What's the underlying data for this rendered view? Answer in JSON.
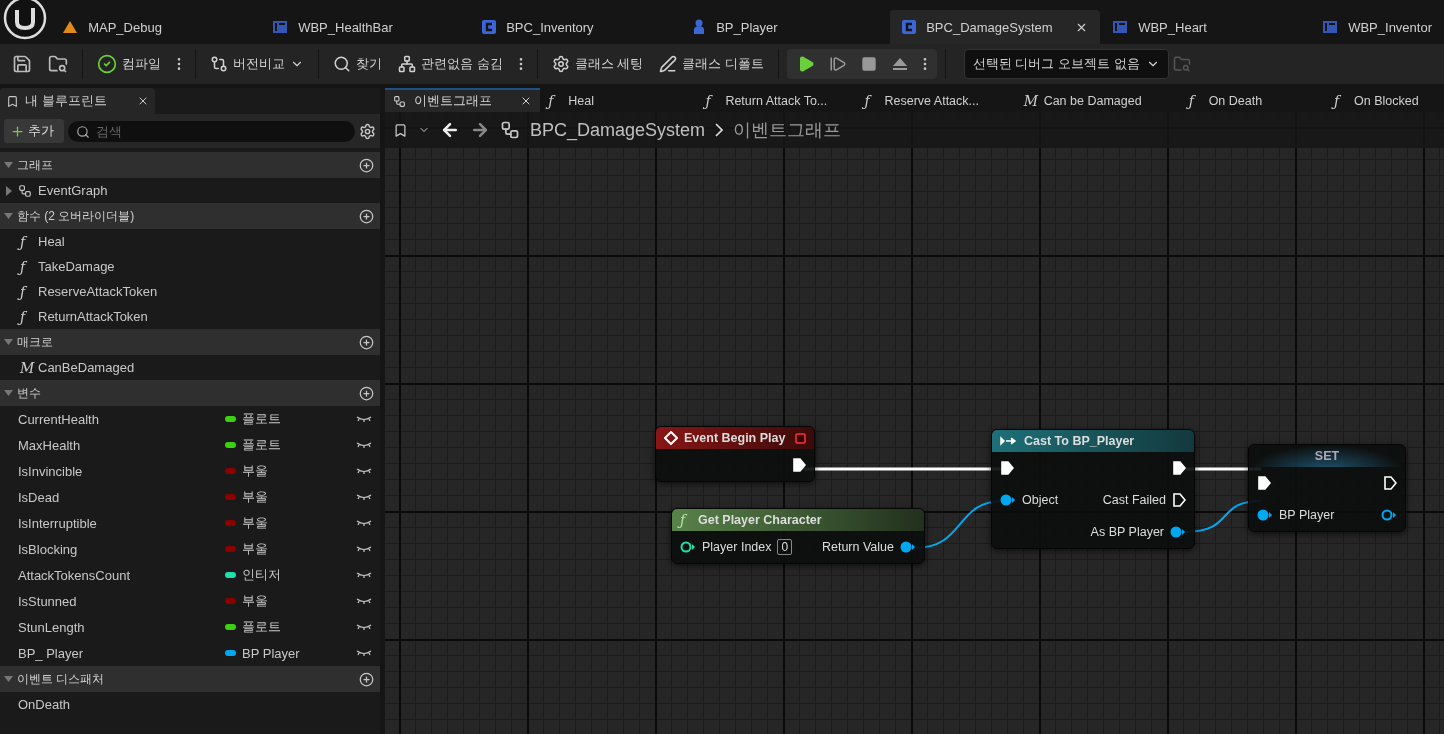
{
  "doc_tabs": [
    {
      "label": "MAP_Debug",
      "kind": "map",
      "selected": false
    },
    {
      "label": "WBP_HealthBar",
      "kind": "widget",
      "selected": false
    },
    {
      "label": "BPC_Inventory",
      "kind": "component",
      "selected": false
    },
    {
      "label": "BP_Player",
      "kind": "actor",
      "selected": false
    },
    {
      "label": "BPC_DamageSystem",
      "kind": "component",
      "selected": true
    },
    {
      "label": "WBP_Heart",
      "kind": "widget",
      "selected": false
    },
    {
      "label": "WBP_Inventor",
      "kind": "widget",
      "selected": false
    }
  ],
  "toolbar": {
    "compile": "컴파일",
    "diff": "버전비교",
    "find": "찾기",
    "hide_unrelated": "관련없음 숨김",
    "class_settings": "클래스 세팅",
    "class_defaults": "클래스 디폴트",
    "debug_object": "선택된 디버그 오브젝트 없음"
  },
  "my_blueprint": {
    "title": "내 블루프린트",
    "add": "추가",
    "search_placeholder": "검색",
    "sections": [
      {
        "title": "그래프",
        "items": [
          {
            "kind": "graph",
            "label": "EventGraph"
          }
        ]
      },
      {
        "title": "함수 (2 오버라이더블)",
        "items": [
          {
            "kind": "function",
            "glyph": "ƒ",
            "label": "Heal"
          },
          {
            "kind": "function",
            "glyph": "ƒ",
            "label": "TakeDamage"
          },
          {
            "kind": "function",
            "glyph": "ƒ",
            "label": "ReserveAttackToken"
          },
          {
            "kind": "function",
            "glyph": "ƒ",
            "label": "ReturnAttackToken"
          }
        ]
      },
      {
        "title": "매크로",
        "items": [
          {
            "kind": "function",
            "glyph": "M",
            "label": "CanBeDamaged"
          }
        ]
      },
      {
        "title": "변수",
        "items": [
          {
            "kind": "variable",
            "label": "CurrentHealth",
            "type": "플로트",
            "color": "#3bd10e"
          },
          {
            "kind": "variable",
            "label": "MaxHealth",
            "type": "플로트",
            "color": "#3bd10e"
          },
          {
            "kind": "variable",
            "label": "IsInvincible",
            "type": "부울",
            "color": "#8c0000"
          },
          {
            "kind": "variable",
            "label": "IsDead",
            "type": "부울",
            "color": "#8c0000"
          },
          {
            "kind": "variable",
            "label": "IsInterruptible",
            "type": "부울",
            "color": "#8c0000"
          },
          {
            "kind": "variable",
            "label": "IsBlocking",
            "type": "부울",
            "color": "#8c0000"
          },
          {
            "kind": "variable",
            "label": "AttackTokensCount",
            "type": "인티저",
            "color": "#1fe0ac"
          },
          {
            "kind": "variable",
            "label": "IsStunned",
            "type": "부울",
            "color": "#8c0000"
          },
          {
            "kind": "variable",
            "label": "StunLength",
            "type": "플로트",
            "color": "#3bd10e"
          },
          {
            "kind": "variable",
            "label": "BP_ Player",
            "type": "BP Player",
            "color": "#00a8f0"
          }
        ]
      },
      {
        "title": "이벤트 디스패처",
        "items": [
          {
            "kind": "dispatcher",
            "label": "OnDeath"
          }
        ]
      }
    ]
  },
  "graph_tabs": [
    {
      "kind": "graph",
      "label": "이벤트그래프",
      "selected": true
    },
    {
      "kind": "function",
      "glyph": "ƒ",
      "label": "Heal",
      "selected": false
    },
    {
      "kind": "function",
      "glyph": "ƒ",
      "label": "Return Attack To...",
      "selected": false
    },
    {
      "kind": "function",
      "glyph": "ƒ",
      "label": "Reserve Attack...",
      "selected": false
    },
    {
      "kind": "function",
      "glyph": "M",
      "label": "Can be Damaged",
      "selected": false
    },
    {
      "kind": "function",
      "glyph": "ƒ",
      "label": "On Death",
      "selected": false
    },
    {
      "kind": "function",
      "glyph": "ƒ",
      "label": "On Blocked",
      "selected": false
    }
  ],
  "breadcrumb": [
    "BPC_DamageSystem",
    "이벤트그래프"
  ],
  "nodes": [
    {
      "kind": "event",
      "title": "Event Begin Play",
      "rows": [
        {
          "out": {
            "kind": "exec",
            "connected": true
          }
        }
      ]
    },
    {
      "kind": "function",
      "glyph": "ƒ",
      "title": "Get Player Character",
      "rows": [
        {
          "in": {
            "kind": "int",
            "label": "Player Index",
            "value": "0",
            "connected": false
          },
          "out": {
            "kind": "object",
            "label": "Return Value",
            "connected": true
          }
        }
      ]
    },
    {
      "kind": "cast",
      "title": "Cast To BP_Player",
      "rows": [
        {
          "in": {
            "kind": "exec",
            "connected": true
          },
          "out": {
            "kind": "exec",
            "connected": true
          }
        },
        {
          "in": {
            "kind": "object",
            "label": "Object",
            "connected": true
          },
          "out": {
            "kind": "exec",
            "label": "Cast Failed",
            "connected": false
          }
        },
        {
          "out": {
            "kind": "object",
            "label": "As BP Player",
            "connected": true
          }
        }
      ]
    },
    {
      "kind": "set",
      "title": "SET",
      "rows": [
        {
          "in": {
            "kind": "exec",
            "connected": true
          },
          "out": {
            "kind": "exec",
            "connected": false
          }
        },
        {
          "in": {
            "kind": "object",
            "label": "BP  Player",
            "connected": true
          },
          "out": {
            "kind": "object",
            "connected": false
          }
        }
      ]
    }
  ]
}
